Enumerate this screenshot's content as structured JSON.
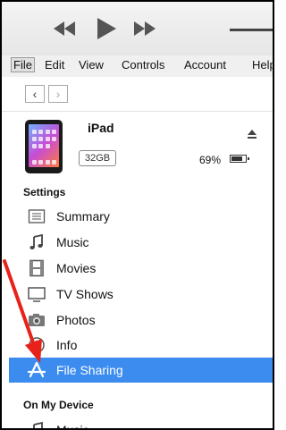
{
  "menu": [
    "File",
    "Edit",
    "View",
    "Controls",
    "Account",
    "Help"
  ],
  "device": {
    "name": "iPad",
    "capacity": "32GB",
    "battery": "69%",
    "battery_level": 0.69
  },
  "settings": {
    "heading": "Settings",
    "items": [
      {
        "label": "Summary",
        "icon": "summary-icon"
      },
      {
        "label": "Music",
        "icon": "music-note-icon"
      },
      {
        "label": "Movies",
        "icon": "film-icon"
      },
      {
        "label": "TV Shows",
        "icon": "tv-icon"
      },
      {
        "label": "Photos",
        "icon": "camera-icon"
      },
      {
        "label": "Info",
        "icon": "info-icon"
      },
      {
        "label": "File Sharing",
        "icon": "app-store-icon",
        "selected": true
      }
    ]
  },
  "on_my_device": {
    "heading": "On My Device",
    "items": [
      {
        "label": "Music",
        "icon": "music-note-icon"
      }
    ]
  },
  "colors": {
    "selection": "#3c8cf0",
    "annotation_arrow": "#e8211a"
  }
}
